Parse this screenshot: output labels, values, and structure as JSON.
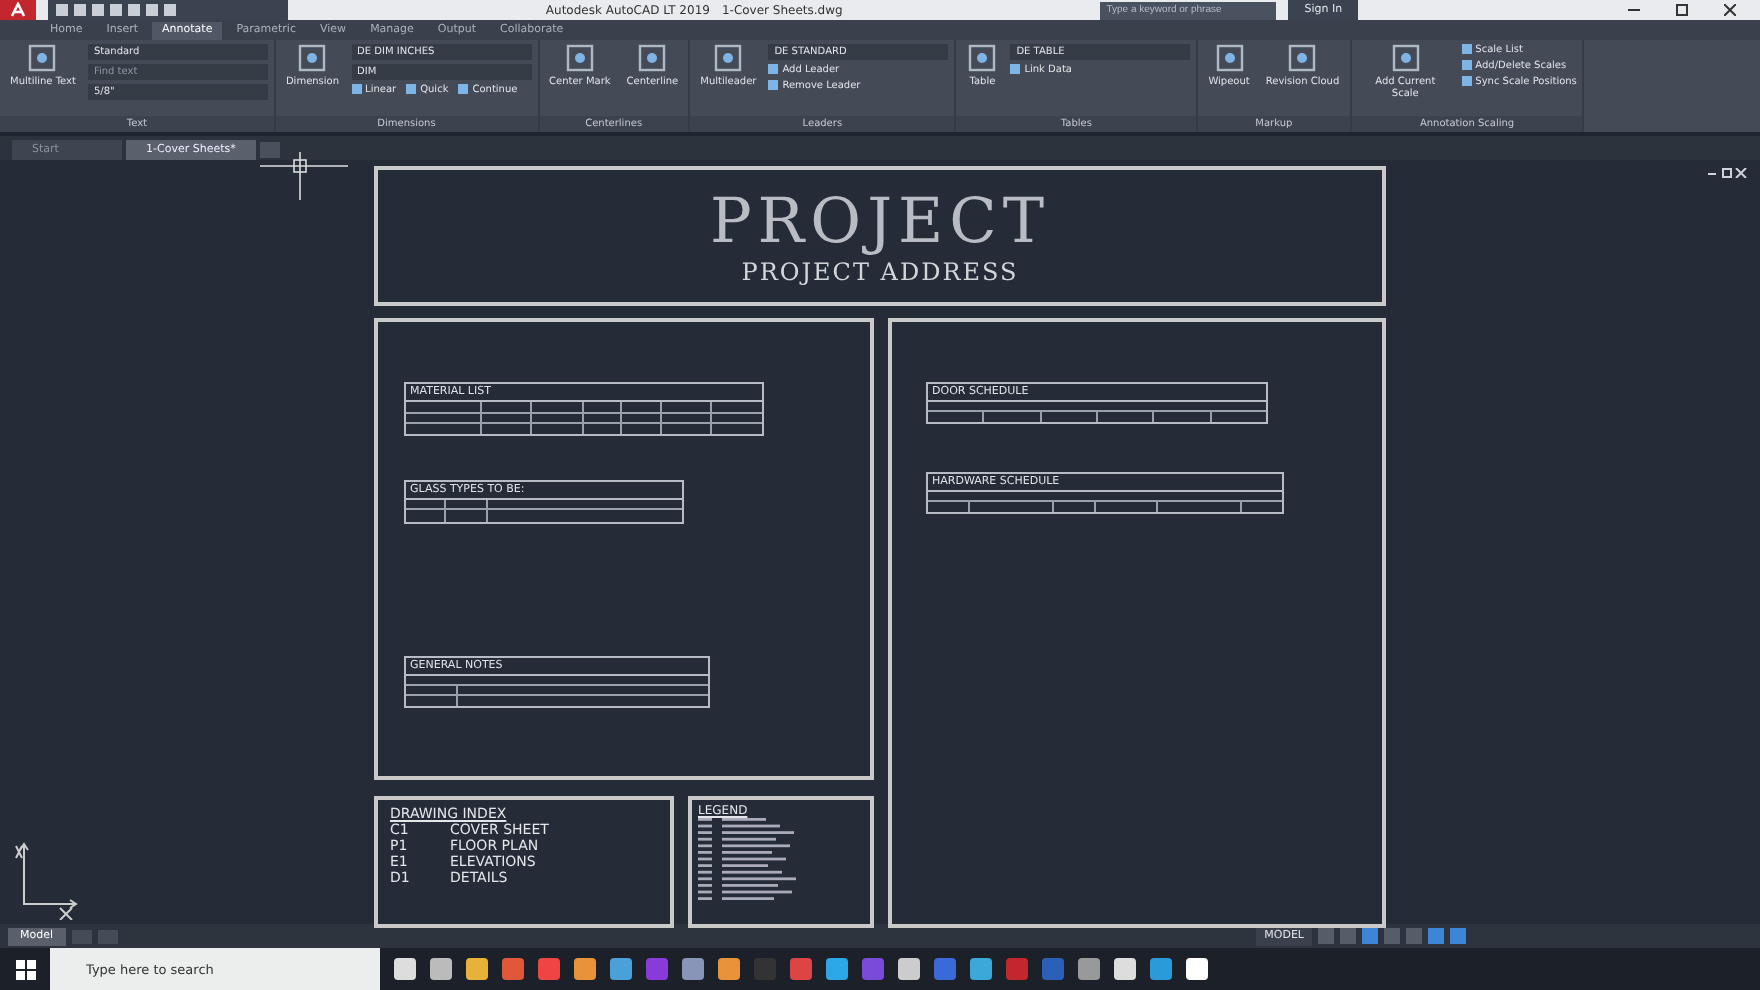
{
  "title_bar": {
    "title": "Autodesk AutoCAD LT 2019",
    "file": "1-Cover Sheets.dwg",
    "search": {
      "placeholder": "Type a keyword or phrase"
    },
    "sign_in": "Sign In"
  },
  "ribbon_tabs": [
    {
      "label": "Home",
      "selected": false
    },
    {
      "label": "Insert",
      "selected": false
    },
    {
      "label": "Annotate",
      "selected": true
    },
    {
      "label": "Parametric",
      "selected": false
    },
    {
      "label": "View",
      "selected": false
    },
    {
      "label": "Manage",
      "selected": false
    },
    {
      "label": "Output",
      "selected": false
    },
    {
      "label": "Collaborate",
      "selected": false
    }
  ],
  "ribbon_panels": [
    {
      "title": "Text",
      "large": [
        "Multiline Text"
      ],
      "fields": [
        {
          "value": "Standard"
        },
        {
          "placeholder": "Find text"
        },
        {
          "value": "5/8\""
        }
      ]
    },
    {
      "title": "Dimensions",
      "kind": "row",
      "large": [
        "Dimension"
      ],
      "fields": [
        {
          "value": "DE DIM INCHES"
        },
        {
          "value": "DIM"
        }
      ],
      "small": [
        "Linear",
        "Quick",
        "Continue"
      ]
    },
    {
      "title": "Centerlines",
      "large": [
        "Center Mark",
        "Centerline"
      ]
    },
    {
      "title": "Leaders",
      "kind": "stack",
      "large": [
        "Multileader"
      ],
      "fields": [
        {
          "value": "DE STANDARD"
        }
      ],
      "small": [
        "Add Leader",
        "Remove Leader"
      ]
    },
    {
      "title": "Tables",
      "kind": "stack",
      "large": [
        "Table"
      ],
      "fields": [
        {
          "value": "DE TABLE"
        }
      ],
      "small": [
        "Link Data"
      ]
    },
    {
      "title": "Markup",
      "large": [
        "Wipeout",
        "Revision Cloud"
      ]
    },
    {
      "title": "Annotation Scaling",
      "kind": "stack",
      "large": [
        "Add Current Scale"
      ],
      "small": [
        "Scale List",
        "Add/Delete Scales",
        "Sync Scale Positions"
      ]
    }
  ],
  "file_tabs": [
    {
      "label": "Start",
      "selected": false
    },
    {
      "label": "1-Cover Sheets*",
      "selected": true
    }
  ],
  "sheet": {
    "title": "PROJECT",
    "subtitle": "PROJECT ADDRESS",
    "tables": [
      {
        "title": "MATERIAL LIST"
      },
      {
        "title": "GLASS TYPES TO BE:"
      },
      {
        "title": "GENERAL NOTES"
      },
      {
        "title": "DOOR SCHEDULE"
      },
      {
        "title": "HARDWARE SCHEDULE"
      }
    ],
    "drawing_index": {
      "title": "DRAWING INDEX",
      "entries": [
        {
          "code": "C1",
          "name": "COVER SHEET"
        },
        {
          "code": "P1",
          "name": "FLOOR PLAN"
        },
        {
          "code": "E1",
          "name": "ELEVATIONS"
        },
        {
          "code": "D1",
          "name": "DETAILS"
        }
      ]
    },
    "legend": {
      "title": "LEGEND"
    }
  },
  "layout_tabs": [
    {
      "label": "Model",
      "selected": true
    }
  ],
  "status_bar": {
    "space": "MODEL"
  },
  "taskbar": {
    "search": {
      "placeholder": "Type here to search"
    }
  }
}
